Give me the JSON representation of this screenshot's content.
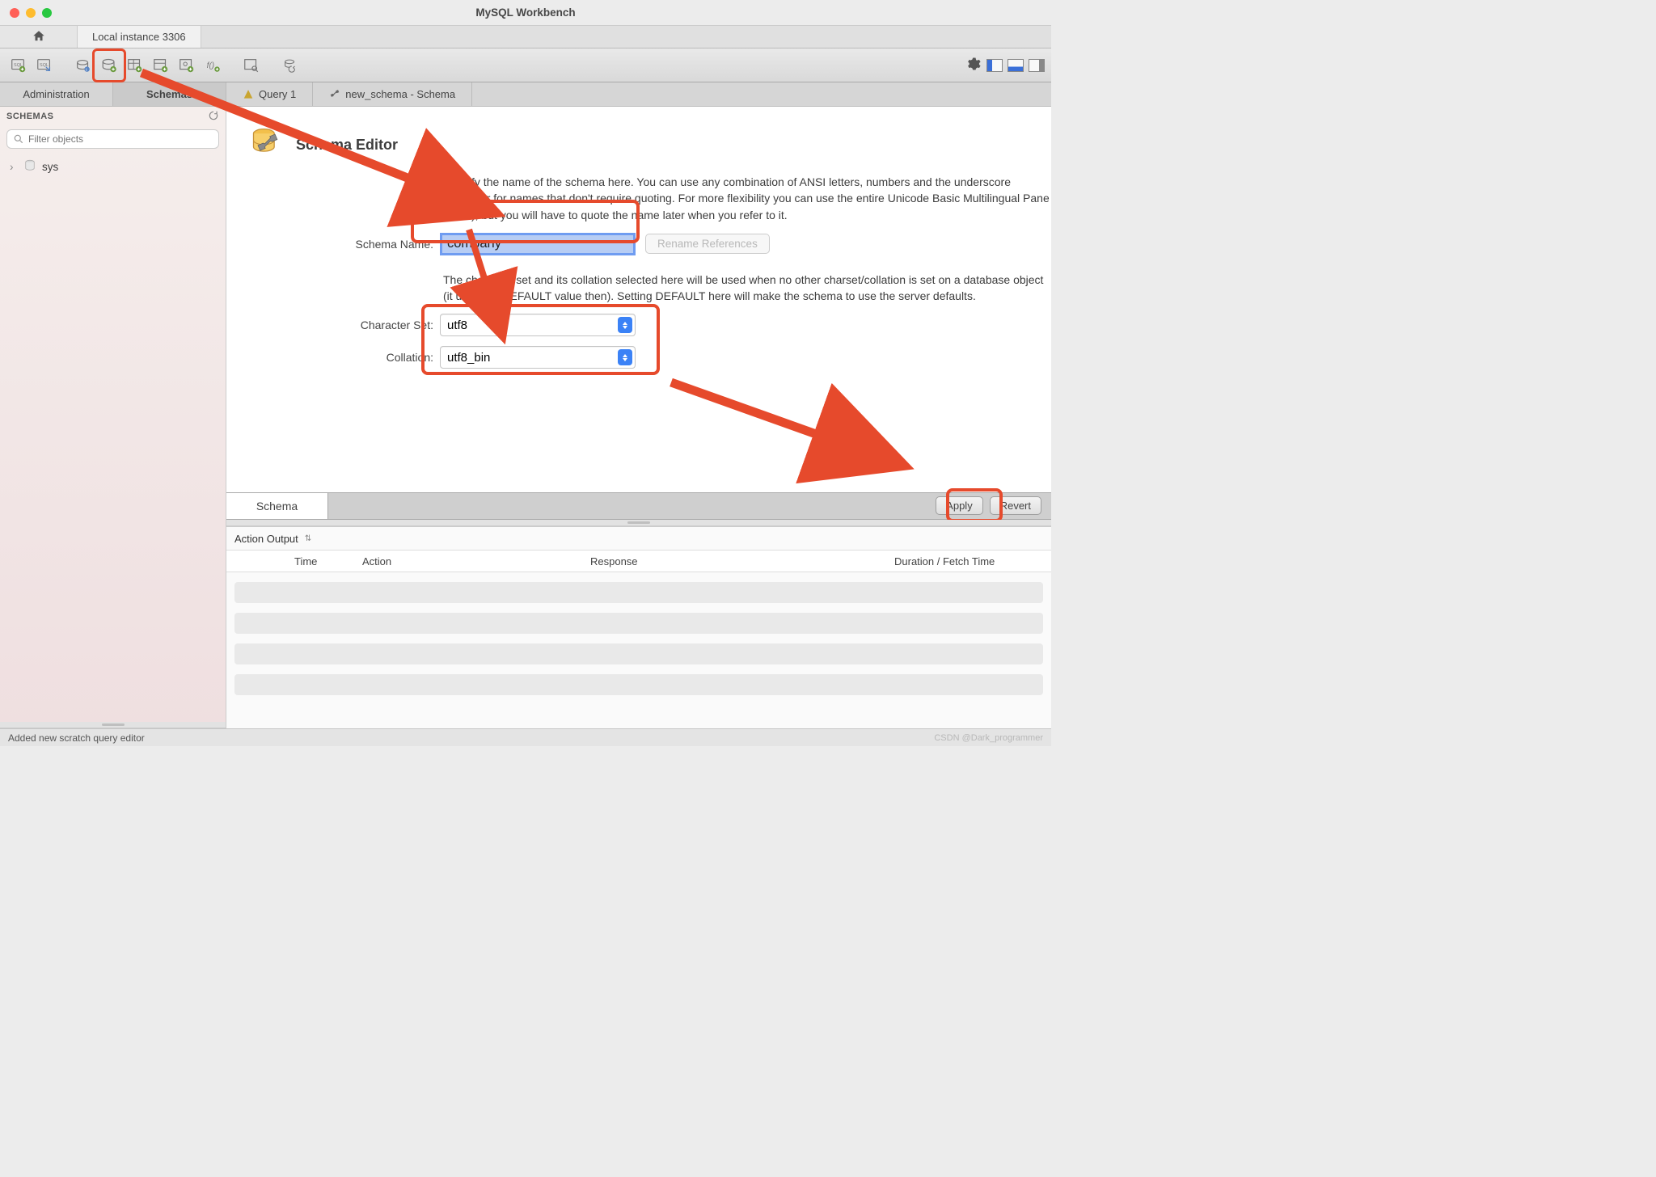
{
  "app_title": "MySQL Workbench",
  "connection_tab": "Local instance 3306",
  "side_tabs": {
    "admin": "Administration",
    "schemas": "Schemas"
  },
  "editor_tabs": [
    {
      "label": "Query 1",
      "icon": "bolt"
    },
    {
      "label": "new_schema - Schema",
      "icon": "wrench"
    }
  ],
  "schemas_header": "SCHEMAS",
  "filter_placeholder": "Filter objects",
  "tree_item": "sys",
  "editor_title": "Schema Editor",
  "desc1": "Specify the name of the schema here. You can use any combination of ANSI letters, numbers and the underscore character for names that don't require quoting. For more flexibility you can use the entire Unicode Basic Multilingual Pane (BMP), but you will have to quote the name later when you refer to it.",
  "schema_name_label": "Schema Name:",
  "schema_name_value": "company",
  "rename_refs": "Rename References",
  "desc2": "The character set and its collation selected here will be used when no other charset/collation is set on a database object (it uses the DEFAULT value then). Setting DEFAULT here will make the schema to use the server defaults.",
  "charset_label": "Character Set:",
  "charset_value": "utf8",
  "collation_label": "Collation:",
  "collation_value": "utf8_bin",
  "schema_bottom_tab": "Schema",
  "apply": "Apply",
  "revert": "Revert",
  "output_header": "Action Output",
  "cols": {
    "time": "Time",
    "action": "Action",
    "response": "Response",
    "duration": "Duration / Fetch Time"
  },
  "status_text": "Added new scratch query editor",
  "watermark": "CSDN @Dark_programmer"
}
